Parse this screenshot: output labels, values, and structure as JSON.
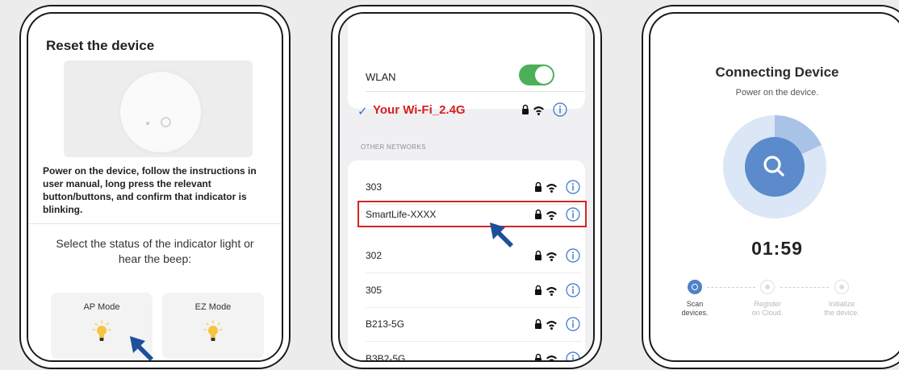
{
  "phone1": {
    "title": "Reset the device",
    "description": "Power on the device, follow the instructions in user manual, long press the relevant button/buttons, and confirm that indicator is blinking.",
    "sheet_title": "Select the status of the indicator light or hear the beep:",
    "modes": [
      {
        "label": "AP Mode",
        "icon": "lightbulb-icon"
      },
      {
        "label": "EZ Mode",
        "icon": "lightbulb-icon"
      }
    ]
  },
  "phone2": {
    "wlan_label": "WLAN",
    "wlan_enabled": true,
    "connected_network": "Your Wi-Fi_2.4G",
    "section_header": "OTHER NETWORKS",
    "networks": [
      {
        "name": "303",
        "highlighted": false
      },
      {
        "name": "SmartLife-XXXX",
        "highlighted": true
      },
      {
        "name": "302",
        "highlighted": false
      },
      {
        "name": "305",
        "highlighted": false
      },
      {
        "name": "B213-5G",
        "highlighted": false
      },
      {
        "name": "B3B2-5G",
        "highlighted": false
      }
    ]
  },
  "phone3": {
    "title": "Connecting Device",
    "subtitle": "Power on the device.",
    "timer": "01:59",
    "progress_fraction": 0.18,
    "steps": [
      {
        "label": "Scan\ndevices.",
        "active": true
      },
      {
        "label": "Register\non Cloud.",
        "active": false
      },
      {
        "label": "Initialize\nthe device.",
        "active": false
      }
    ]
  },
  "colors": {
    "accent_blue": "#4e81c7",
    "highlight_red": "#d32626",
    "toggle_green": "#4cb05a",
    "cursor_blue": "#1d4f9c"
  }
}
